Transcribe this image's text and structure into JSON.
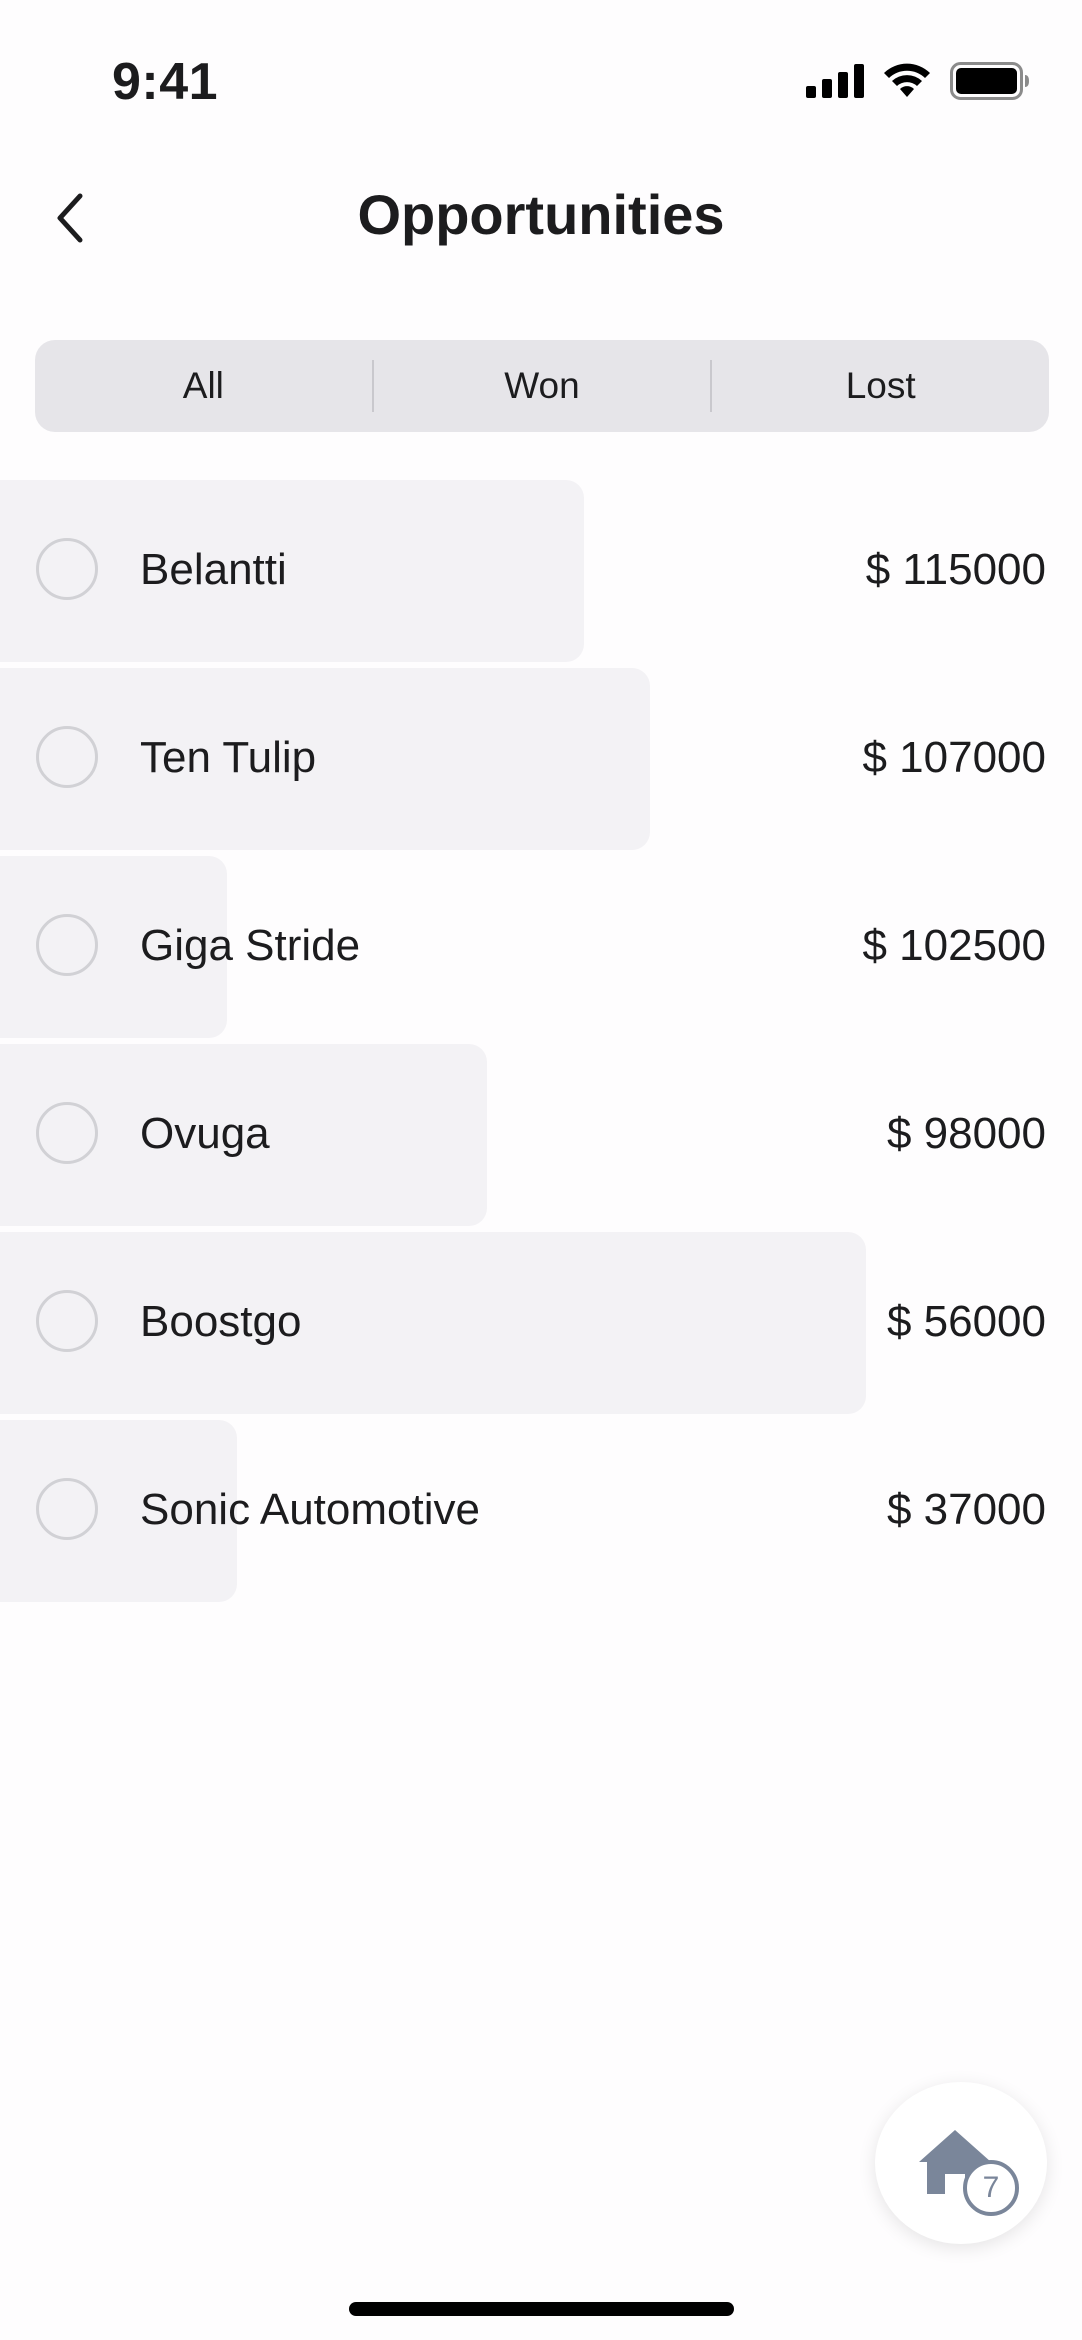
{
  "status_bar": {
    "time": "9:41",
    "icons": [
      "cellular-signal-icon",
      "wifi-icon",
      "battery-icon"
    ]
  },
  "nav": {
    "title": "Opportunities",
    "back_icon": "chevron-left-icon"
  },
  "segments": [
    {
      "label": "All"
    },
    {
      "label": "Won"
    },
    {
      "label": "Lost"
    }
  ],
  "opportunities": [
    {
      "name": "Belantti",
      "amount": "$ 115000"
    },
    {
      "name": "Ten Tulip",
      "amount": "$ 107000"
    },
    {
      "name": "Giga Stride",
      "amount": "$ 102500"
    },
    {
      "name": "Ovuga",
      "amount": "$ 98000"
    },
    {
      "name": "Boostgo",
      "amount": "$ 56000"
    },
    {
      "name": "Sonic Automotive",
      "amount": "$ 37000"
    }
  ],
  "fab": {
    "icon": "home-icon",
    "badge": "7"
  },
  "colors": {
    "background": "#fefdfe",
    "row_bar": "#f3f2f5",
    "segment_bg": "#e6e5e9",
    "fab_icon": "#7a869a",
    "text": "#1c1c1e"
  }
}
